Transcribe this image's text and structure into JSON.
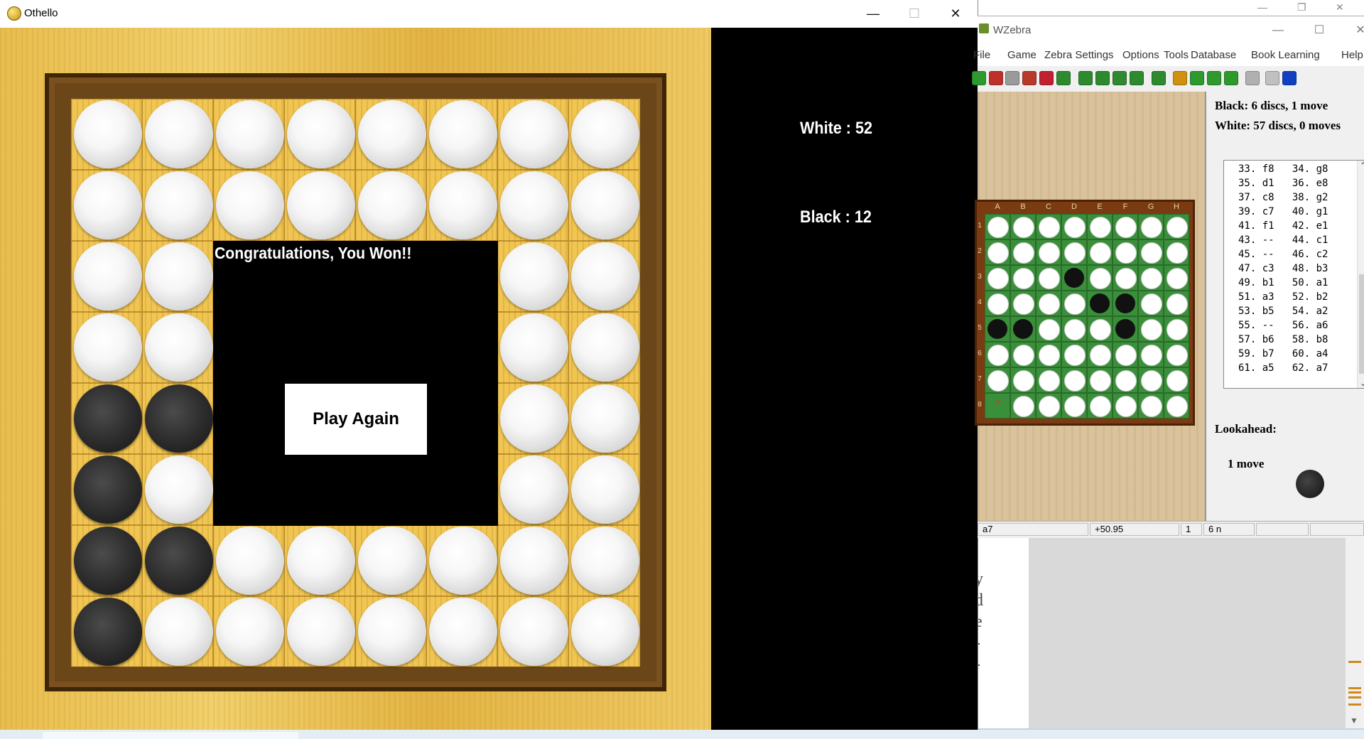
{
  "othello": {
    "title": "Othello",
    "controls": {
      "minimize": "—",
      "maximize": "☐",
      "close": "✕"
    },
    "board": [
      [
        "W",
        "W",
        "W",
        "W",
        "W",
        "W",
        "W",
        "W"
      ],
      [
        "W",
        "W",
        "W",
        "W",
        "W",
        "W",
        "W",
        "W"
      ],
      [
        "W",
        "W",
        "",
        "",
        "",
        "",
        "W",
        "W"
      ],
      [
        "W",
        "W",
        "",
        "",
        "",
        "",
        "W",
        "W"
      ],
      [
        "B",
        "B",
        "",
        "",
        "",
        "",
        "W",
        "W"
      ],
      [
        "B",
        "W",
        "",
        "",
        "",
        "",
        "W",
        "W"
      ],
      [
        "B",
        "B",
        "W",
        "W",
        "W",
        "W",
        "W",
        "W"
      ],
      [
        "B",
        "W",
        "W",
        "W",
        "W",
        "W",
        "W",
        "W"
      ]
    ],
    "result_message": "Congratulations, You Won!!",
    "play_again_label": "Play Again",
    "score_white": "White : 52",
    "score_black": "Black : 12"
  },
  "wzebra": {
    "title": "WZebra",
    "menu": [
      "File",
      "Game",
      "Zebra Settings",
      "Options",
      "Tools",
      "Database",
      "Book Learning",
      "Help"
    ],
    "toolbar_colors": [
      "#2e9a2e",
      "#c0302a",
      "#9a9a9a",
      "#b83a2a",
      "#c02030",
      "#2e8a2e",
      "#2e8a2e",
      "#2e8a2e",
      "#2e8a2e",
      "#2e8a2e",
      "#2e8a2e",
      "#d09010",
      "#2e9a2e",
      "#2e9a2e",
      "#2e9a2e",
      "#b0b0b0",
      "#c0c0c0",
      "#1040c0"
    ],
    "columns": [
      "A",
      "B",
      "C",
      "D",
      "E",
      "F",
      "G",
      "H"
    ],
    "rows": [
      "1",
      "2",
      "3",
      "4",
      "5",
      "6",
      "7",
      "8"
    ],
    "board": [
      [
        "W",
        "W",
        "W",
        "W",
        "W",
        "W",
        "W",
        "W"
      ],
      [
        "W",
        "W",
        "W",
        "W",
        "W",
        "W",
        "W",
        "W"
      ],
      [
        "W",
        "W",
        "W",
        "B",
        "W",
        "W",
        "W",
        "W"
      ],
      [
        "W",
        "W",
        "W",
        "W",
        "B",
        "B",
        "W",
        "W"
      ],
      [
        "B",
        "B",
        "W",
        "W",
        "W",
        "B",
        "W",
        "W"
      ],
      [
        "W",
        "W",
        "W",
        "W",
        "W",
        "W",
        "W",
        "W"
      ],
      [
        "W",
        "W",
        "W",
        "W",
        "W",
        "W",
        "W",
        "W"
      ],
      [
        "x",
        "W",
        "W",
        "W",
        "W",
        "W",
        "W",
        "W"
      ]
    ],
    "black_status": "Black:   6 discs, 1 move",
    "white_status": "White:   57 discs, 0 moves",
    "moves": [
      "33. f8   34. g8",
      "35. d1   36. e8",
      "37. c8   38. g2",
      "39. c7   40. g1",
      "41. f1   42. e1",
      "43. --   44. c1",
      "45. --   46. c2",
      "47. c3   48. b3",
      "49. b1   50. a1",
      "51. a3   52. b2",
      "53. b5   54. a2",
      "55. --   56. a6",
      "57. b6   58. b8",
      "59. b7   60. a4",
      "61. a5   62. a7"
    ],
    "lookahead_label": "Lookahead:",
    "lookahead_value": "1 move",
    "status": {
      "last_move": "a7",
      "eval": "+50.95",
      "depth": "1",
      "nodes": "6 n"
    }
  },
  "background": {
    "doc_chars": [
      "y",
      "d",
      "e",
      "-",
      "-"
    ]
  }
}
